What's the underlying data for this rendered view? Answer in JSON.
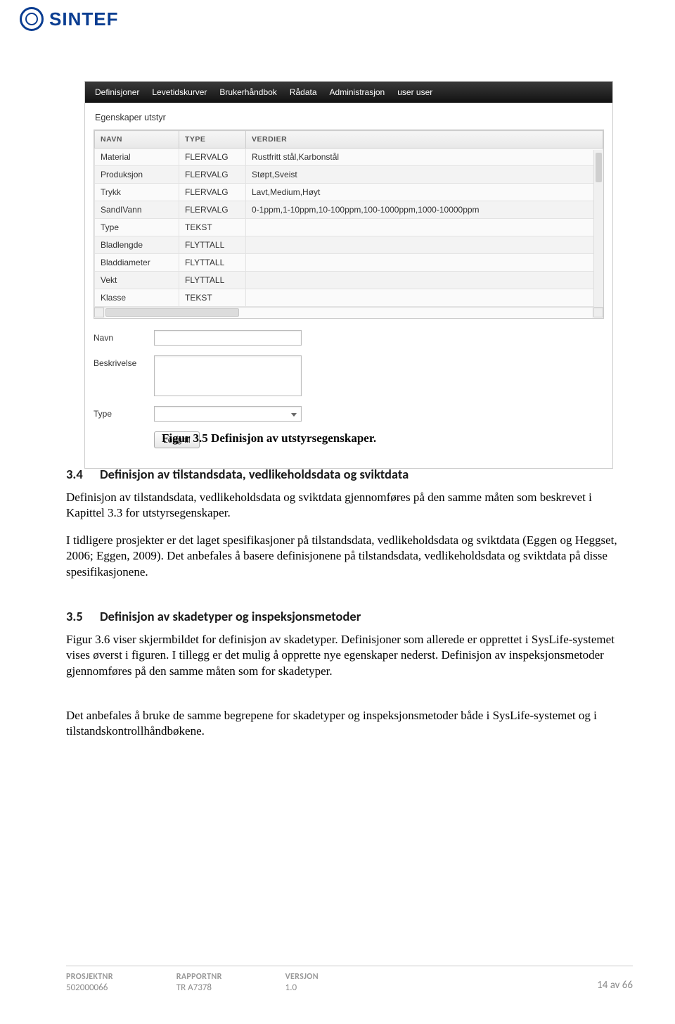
{
  "brand": {
    "name": "SINTEF"
  },
  "app": {
    "menu": [
      "Definisjoner",
      "Levetidskurver",
      "Brukerhåndbok",
      "Rådata",
      "Administrasjon",
      "user user"
    ],
    "section_title": "Egenskaper utstyr",
    "columns": {
      "navn": "NAVN",
      "type": "TYPE",
      "verdier": "VERDIER"
    },
    "rows": [
      {
        "navn": "Material",
        "type": "FLERVALG",
        "verdier": "Rustfritt stål,Karbonstål"
      },
      {
        "navn": "Produksjon",
        "type": "FLERVALG",
        "verdier": "Støpt,Sveist"
      },
      {
        "navn": "Trykk",
        "type": "FLERVALG",
        "verdier": "Lavt,Medium,Høyt"
      },
      {
        "navn": "SandIVann",
        "type": "FLERVALG",
        "verdier": "0-1ppm,1-10ppm,10-100ppm,100-1000ppm,1000-10000ppm"
      },
      {
        "navn": "Type",
        "type": "TEKST",
        "verdier": ""
      },
      {
        "navn": "Bladlengde",
        "type": "FLYTTALL",
        "verdier": ""
      },
      {
        "navn": "Bladdiameter",
        "type": "FLYTTALL",
        "verdier": ""
      },
      {
        "navn": "Vekt",
        "type": "FLYTTALL",
        "verdier": ""
      },
      {
        "navn": "Klasse",
        "type": "TEKST",
        "verdier": ""
      }
    ],
    "form": {
      "navn_label": "Navn",
      "beskrivelse_label": "Beskrivelse",
      "type_label": "Type",
      "add_button": "Legg til"
    }
  },
  "caption": "Figur 3.5  Definisjon av utstyrsegenskaper.",
  "headings": {
    "h34": {
      "num": "3.4",
      "text": "Definisjon av tilstandsdata, vedlikeholdsdata og sviktdata"
    },
    "h35": {
      "num": "3.5",
      "text": "Definisjon av skadetyper og inspeksjonsmetoder"
    }
  },
  "paragraphs": {
    "p1": "Definisjon av tilstandsdata, vedlikeholdsdata og sviktdata gjennomføres på den samme måten som beskrevet i Kapittel 3.3 for utstyrsegenskaper.",
    "p2": "I tidligere prosjekter er det laget spesifikasjoner på tilstandsdata, vedlikeholdsdata og sviktdata (Eggen og Heggset, 2006; Eggen, 2009). Det anbefales å basere definisjonene på tilstandsdata, vedlikeholdsdata og sviktdata på disse spesifikasjonene.",
    "p3": "Figur 3.6 viser skjermbildet for definisjon av skadetyper. Definisjoner som allerede er opprettet i SysLife-systemet vises øverst i figuren. I tillegg er det mulig å opprette nye egenskaper nederst. Definisjon av inspeksjonsmetoder gjennomføres på den samme måten som for skadetyper.",
    "p4": "Det anbefales å bruke de samme begrepene for skadetyper og inspeksjonsmetoder både i SysLife-systemet og i tilstandskontrollhåndbøkene."
  },
  "footer": {
    "prosjektnr_label": "PROSJEKTNR",
    "prosjektnr_value": "502000066",
    "rapportnr_label": "RAPPORTNR",
    "rapportnr_value": "TR A7378",
    "versjon_label": "VERSJON",
    "versjon_value": "1.0",
    "page": "14 av 66"
  }
}
